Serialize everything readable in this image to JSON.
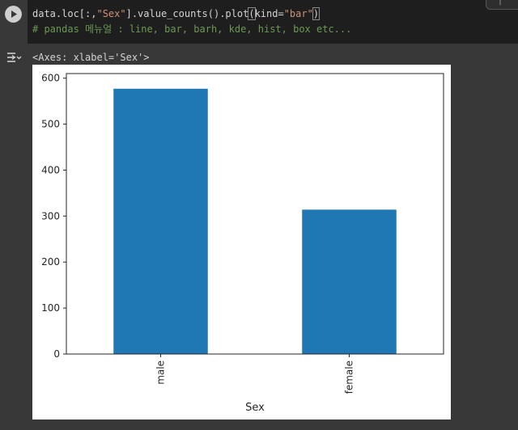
{
  "cell": {
    "code_line1": {
      "a": "data.loc[:,",
      "b": "\"Sex\"",
      "c": "].value_counts().plot",
      "d": "(",
      "e": "kind=",
      "f": "\"bar\"",
      "g": ")"
    },
    "code_line2": "# pandas 메뉴얼 : line, bar, barh, kde, hist, box etc...",
    "run_icon": "play-icon",
    "output_icon": "output-toggle-icon"
  },
  "output": {
    "repr_text": "<Axes: xlabel='Sex'>"
  },
  "chart_data": {
    "type": "bar",
    "categories": [
      "male",
      "female"
    ],
    "values": [
      577,
      314
    ],
    "xlabel": "Sex",
    "ylabel": "",
    "ylim": [
      0,
      610
    ],
    "yticks": [
      0,
      100,
      200,
      300,
      400,
      500,
      600
    ],
    "bar_color": "#1f77b4",
    "grid": false
  }
}
